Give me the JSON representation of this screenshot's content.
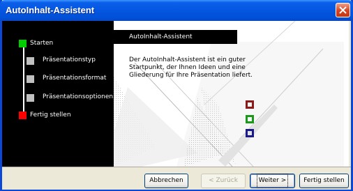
{
  "window": {
    "title": "AutoInhalt-Assistent"
  },
  "steps": [
    {
      "label": "Starten",
      "color": "#00cc00"
    },
    {
      "label": "Präsentationstyp",
      "color": "#c0c0c0"
    },
    {
      "label": "Präsentationsformat",
      "color": "#c0c0c0"
    },
    {
      "label": "Präsentationsoptionen",
      "color": "#c0c0c0"
    },
    {
      "label": "Fertig stellen",
      "color": "#ff0000"
    }
  ],
  "content": {
    "header": "AutoInhalt-Assistent",
    "description": "Der AutoInhalt-Assistent ist ein guter Startpunkt, der Ihnen Ideen und eine Gliederung für Ihre Präsentation liefert.",
    "deco_colors": [
      "#8b1a1a",
      "#1a9a1a",
      "#1a1a8b"
    ]
  },
  "buttons": {
    "cancel": "Abbrechen",
    "back": "< Zurück",
    "next": "Weiter >",
    "finish": "Fertig stellen"
  }
}
